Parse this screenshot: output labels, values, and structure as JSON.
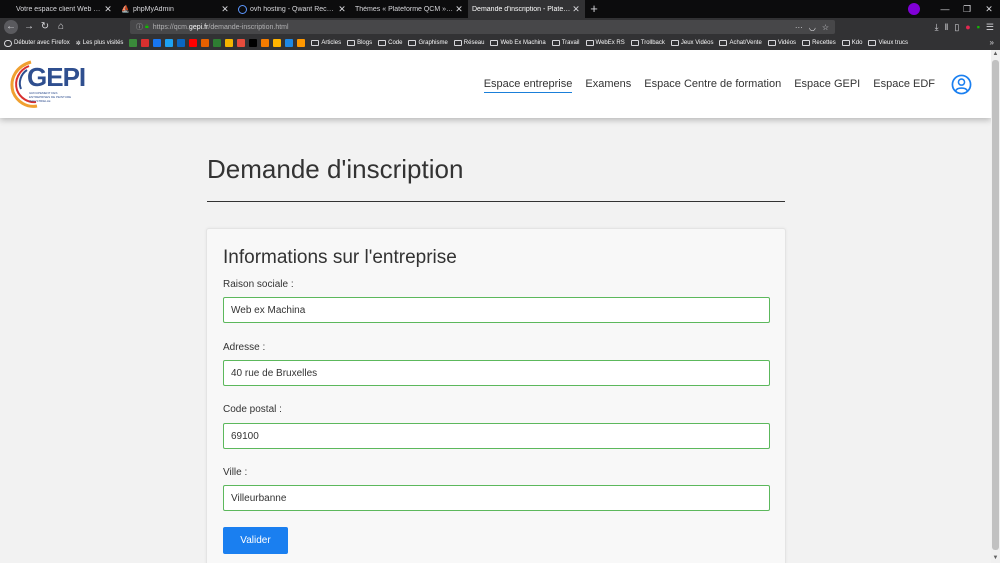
{
  "browser": {
    "tabs": [
      {
        "title": "Votre espace client Web OVH",
        "active": false,
        "favicon": "ovh-icon",
        "favcolor": "#0c0c0d"
      },
      {
        "title": "phpMyAdmin",
        "active": false,
        "favicon": "phpmyadmin-icon",
        "favcolor": "#f3a21c"
      },
      {
        "title": "ovh hosting - Qwant Recherche",
        "active": false,
        "favicon": "qwant-icon",
        "favcolor": "#5c97ff"
      },
      {
        "title": "Thèmes « Plateforme QCM » Modu",
        "active": false,
        "favicon": "wordpress-icon",
        "favcolor": "#0c0c0d"
      },
      {
        "title": "Demande d'inscription - Plateform",
        "active": true,
        "favicon": "page-icon",
        "favcolor": "#323234"
      }
    ],
    "new_tab": "+",
    "url_prefix": "https://qcm.",
    "url_domain": "gepi.fr",
    "url_path": "/demande-inscription.html",
    "url_more": "···",
    "bookmarks": [
      {
        "label": "Débuter avec Firefox",
        "type": "firefox"
      },
      {
        "label": "Les plus visités",
        "type": "gear"
      },
      {
        "label": "Articles",
        "type": "folder"
      },
      {
        "label": "Blogs",
        "type": "folder"
      },
      {
        "label": "Code",
        "type": "folder"
      },
      {
        "label": "Graphisme",
        "type": "folder"
      },
      {
        "label": "Réseau",
        "type": "folder"
      },
      {
        "label": "Web Ex Machina",
        "type": "folder"
      },
      {
        "label": "Travail",
        "type": "folder"
      },
      {
        "label": "WebEx RS",
        "type": "folder"
      },
      {
        "label": "Trollback",
        "type": "folder"
      },
      {
        "label": "Jeux Vidéos",
        "type": "folder"
      },
      {
        "label": "Achat/Vente",
        "type": "folder"
      },
      {
        "label": "Vidéos",
        "type": "folder"
      },
      {
        "label": "Recettes",
        "type": "folder"
      },
      {
        "label": "Kdo",
        "type": "folder"
      },
      {
        "label": "Vieux trucs",
        "type": "folder"
      }
    ],
    "bookmark_icon_colors": [
      "#3a8a3a",
      "#d9302f",
      "#1877f2",
      "#1da1f2",
      "#0a66c2",
      "#ff0000",
      "#e66000",
      "#2e7d32",
      "#f4b400",
      "#e74c3c",
      "#000000",
      "#f57c00",
      "#ffb300",
      "#1e88e5",
      "#ff9800"
    ],
    "bookmarks_more": "»"
  },
  "site": {
    "logo_text": "GEPI",
    "logo_sub": "GROUPEMENT DES ENTREPRISES DE PEINTURE INDUSTRIELLE",
    "nav": [
      {
        "label": "Espace entreprise",
        "active": true
      },
      {
        "label": "Examens",
        "active": false
      },
      {
        "label": "Espace Centre de formation",
        "active": false
      },
      {
        "label": "Espace GEPI",
        "active": false
      },
      {
        "label": "Espace EDF",
        "active": false
      }
    ],
    "accent_color": "#1a7ff0",
    "valid_color": "#5cb85c"
  },
  "page": {
    "title": "Demande d'inscription",
    "card_title": "Informations sur l'entreprise",
    "fields": [
      {
        "label": "Raison sociale :",
        "value": "Web ex Machina"
      },
      {
        "label": "Adresse :",
        "value": "40 rue de Bruxelles"
      },
      {
        "label": "Code postal :",
        "value": "69100"
      },
      {
        "label": "Ville :",
        "value": "Villeurbanne"
      }
    ],
    "submit_label": "Valider"
  }
}
